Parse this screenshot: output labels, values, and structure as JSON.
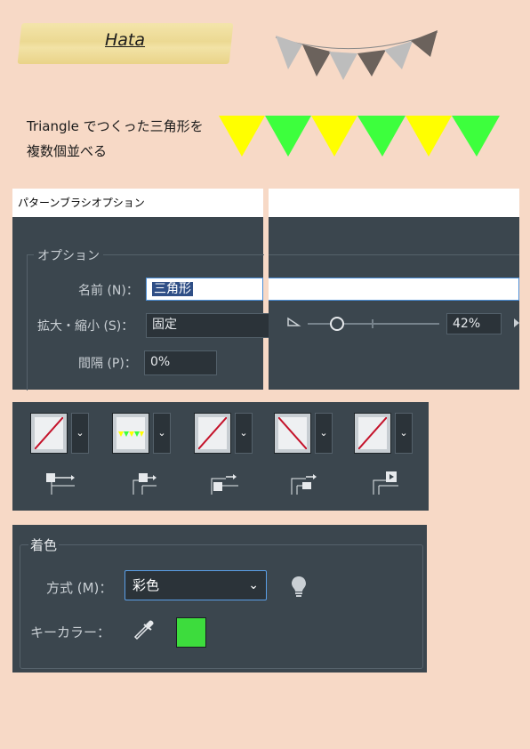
{
  "title": "Hata",
  "description": {
    "line1": "Triangle でつくった三角形を",
    "line2": "複数個並べる"
  },
  "colors": {
    "page_bg": "#f7d9c6",
    "tri_yellow": "#ffff00",
    "tri_green": "#3dff3d",
    "panel_bg": "#3b464e",
    "key_color": "#3ddc3d",
    "bunting_gray": "#bdbdbd",
    "bunting_dark": "#6b625c"
  },
  "brush_dialog": {
    "title": "パターンブラシオプション",
    "options_legend": "オプション",
    "name_label": "名前 (N)：",
    "name_value": "三角形",
    "scale_label": "拡大・縮小 (S)：",
    "scale_value": "固定",
    "scale_percent": "42%",
    "spacing_label": "間隔 (P)：",
    "spacing_value": "0%"
  },
  "tiles": {
    "icons": [
      "side-tile-icon",
      "outer-corner-tile-icon",
      "inner-corner-tile-icon",
      "start-tile-icon",
      "end-tile-icon"
    ]
  },
  "colorize": {
    "heading": "着色",
    "method_label": "方式 (M)：",
    "method_value": "彩色",
    "key_color_label": "キーカラー："
  }
}
